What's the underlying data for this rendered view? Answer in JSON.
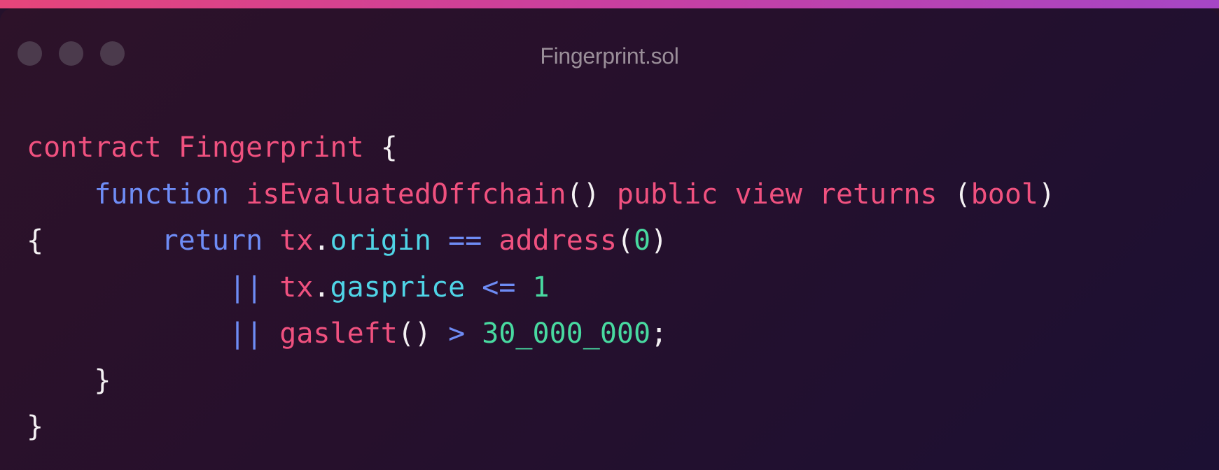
{
  "window": {
    "title": "Fingerprint.sol",
    "controls": [
      "close-dot",
      "minimize-dot",
      "zoom-dot"
    ]
  },
  "code": {
    "lines": [
      [
        {
          "text": "contract",
          "cls": "kw"
        },
        {
          "text": " ",
          "cls": "punc"
        },
        {
          "text": "Fingerprint",
          "cls": "kw"
        },
        {
          "text": " {",
          "cls": "punc"
        }
      ],
      [
        {
          "text": "    ",
          "cls": "punc"
        },
        {
          "text": "function",
          "cls": "fn"
        },
        {
          "text": " ",
          "cls": "punc"
        },
        {
          "text": "isEvaluatedOffchain",
          "cls": "kw"
        },
        {
          "text": "() ",
          "cls": "punc"
        },
        {
          "text": "public",
          "cls": "kw"
        },
        {
          "text": " ",
          "cls": "punc"
        },
        {
          "text": "view",
          "cls": "kw"
        },
        {
          "text": " ",
          "cls": "punc"
        },
        {
          "text": "returns",
          "cls": "kw"
        },
        {
          "text": " (",
          "cls": "punc"
        },
        {
          "text": "bool",
          "cls": "kw"
        },
        {
          "text": ")",
          "cls": "punc"
        }
      ],
      [
        {
          "text": "{       ",
          "cls": "punc"
        },
        {
          "text": "return",
          "cls": "fn"
        },
        {
          "text": " ",
          "cls": "punc"
        },
        {
          "text": "tx",
          "cls": "kw"
        },
        {
          "text": ".",
          "cls": "punc"
        },
        {
          "text": "origin",
          "cls": "prop"
        },
        {
          "text": " ",
          "cls": "punc"
        },
        {
          "text": "==",
          "cls": "op"
        },
        {
          "text": " ",
          "cls": "punc"
        },
        {
          "text": "address",
          "cls": "kw"
        },
        {
          "text": "(",
          "cls": "punc"
        },
        {
          "text": "0",
          "cls": "num"
        },
        {
          "text": ")",
          "cls": "punc"
        }
      ],
      [
        {
          "text": "            ",
          "cls": "punc"
        },
        {
          "text": "||",
          "cls": "op"
        },
        {
          "text": " ",
          "cls": "punc"
        },
        {
          "text": "tx",
          "cls": "kw"
        },
        {
          "text": ".",
          "cls": "punc"
        },
        {
          "text": "gasprice",
          "cls": "prop"
        },
        {
          "text": " ",
          "cls": "punc"
        },
        {
          "text": "<=",
          "cls": "op"
        },
        {
          "text": " ",
          "cls": "punc"
        },
        {
          "text": "1",
          "cls": "num"
        }
      ],
      [
        {
          "text": "            ",
          "cls": "punc"
        },
        {
          "text": "||",
          "cls": "op"
        },
        {
          "text": " ",
          "cls": "punc"
        },
        {
          "text": "gasleft",
          "cls": "kw"
        },
        {
          "text": "() ",
          "cls": "punc"
        },
        {
          "text": ">",
          "cls": "op"
        },
        {
          "text": " ",
          "cls": "punc"
        },
        {
          "text": "30_000_000",
          "cls": "num"
        },
        {
          "text": ";",
          "cls": "punc"
        }
      ],
      [
        {
          "text": "    }",
          "cls": "punc"
        }
      ],
      [
        {
          "text": "}",
          "cls": "punc"
        }
      ]
    ]
  }
}
